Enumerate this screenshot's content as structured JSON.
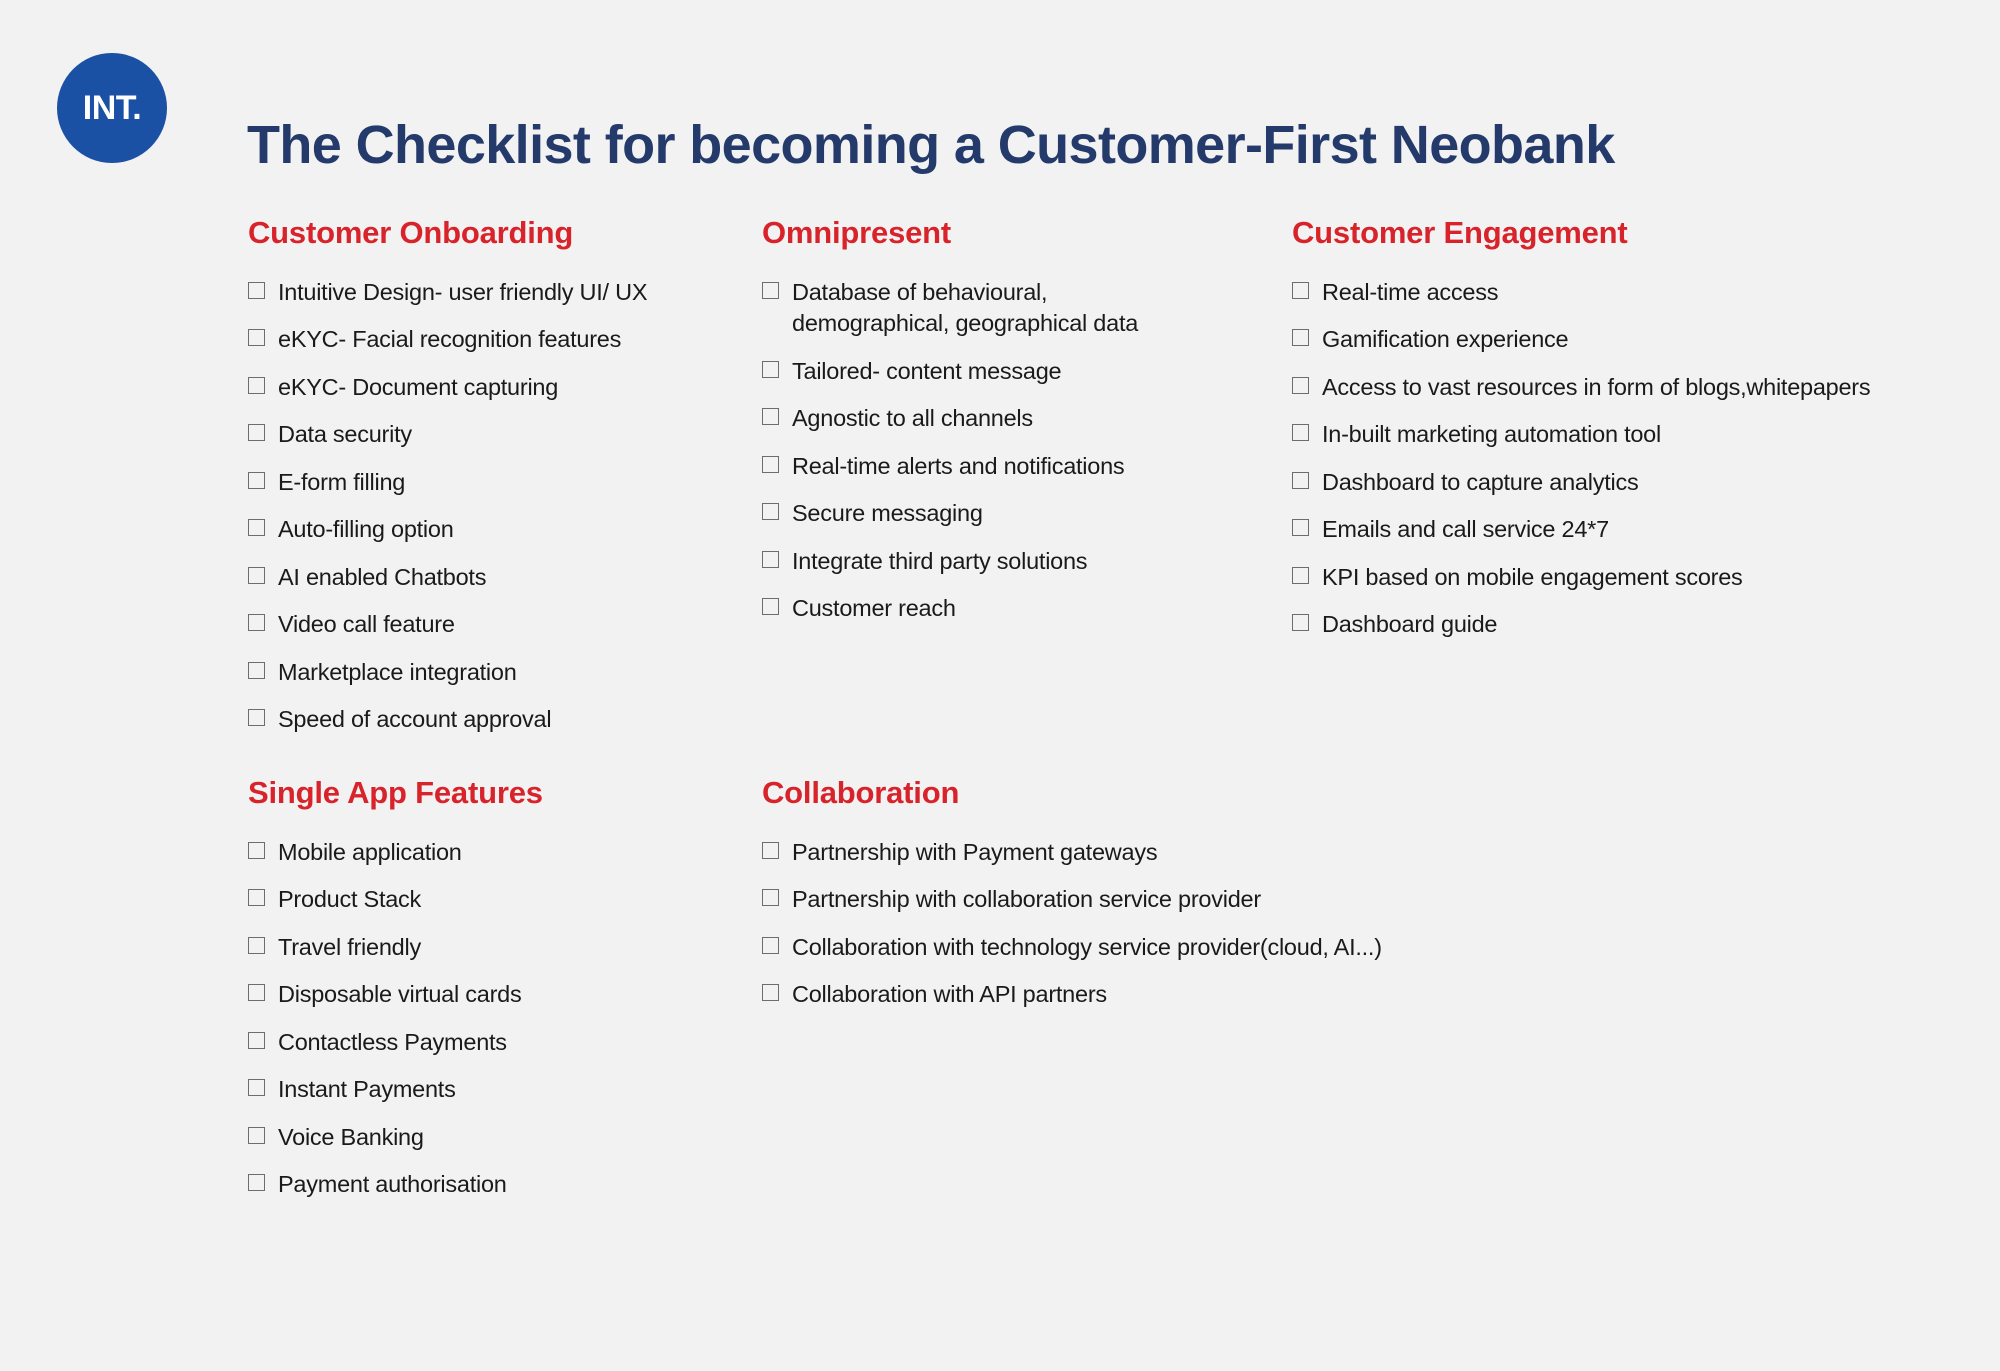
{
  "header": {
    "logo_text": "INT.",
    "logo_color": "#1b51a4",
    "title": "The Checklist for becoming a Customer-First Neobank",
    "title_color": "#243a6b"
  },
  "theme": {
    "background": "#f2f2f2",
    "section_heading_color": "#d8232a",
    "item_text_color": "#1a1a1a",
    "checkbox_border_color": "#6d6d6d"
  },
  "sections": [
    {
      "id": "customer-onboarding",
      "title": "Customer Onboarding",
      "items": [
        "Intuitive Design- user friendly UI/ UX",
        "eKYC- Facial recognition features",
        "eKYC- Document capturing",
        "Data security",
        "E-form filling",
        "Auto-filling option",
        "AI enabled Chatbots",
        "Video call feature",
        "Marketplace integration",
        "Speed of account approval"
      ]
    },
    {
      "id": "omnipresent",
      "title": "Omnipresent",
      "items": [
        "Database of behavioural, demographical, geographical data",
        "Tailored- content message",
        "Agnostic to all channels",
        "Real-time alerts and notifications",
        "Secure messaging",
        "Integrate third party solutions",
        "Customer reach"
      ]
    },
    {
      "id": "customer-engagement",
      "title": "Customer Engagement",
      "items": [
        "Real-time access",
        "Gamification experience",
        "Access to vast resources in form of blogs,whitepapers",
        "In-built marketing automation tool",
        "Dashboard to capture analytics",
        "Emails and call service 24*7",
        "KPI based on mobile engagement scores",
        "Dashboard guide"
      ]
    },
    {
      "id": "single-app-features",
      "title": "Single App Features",
      "items": [
        "Mobile application",
        "Product Stack",
        "Travel friendly",
        "Disposable virtual cards",
        "Contactless Payments",
        "Instant Payments",
        "Voice Banking",
        "Payment authorisation"
      ]
    },
    {
      "id": "collaboration",
      "title": "Collaboration",
      "items": [
        "Partnership with Payment gateways",
        "Partnership with collaboration service provider",
        "Collaboration with technology service provider(cloud, AI...)",
        "Collaboration with API partners"
      ]
    }
  ]
}
